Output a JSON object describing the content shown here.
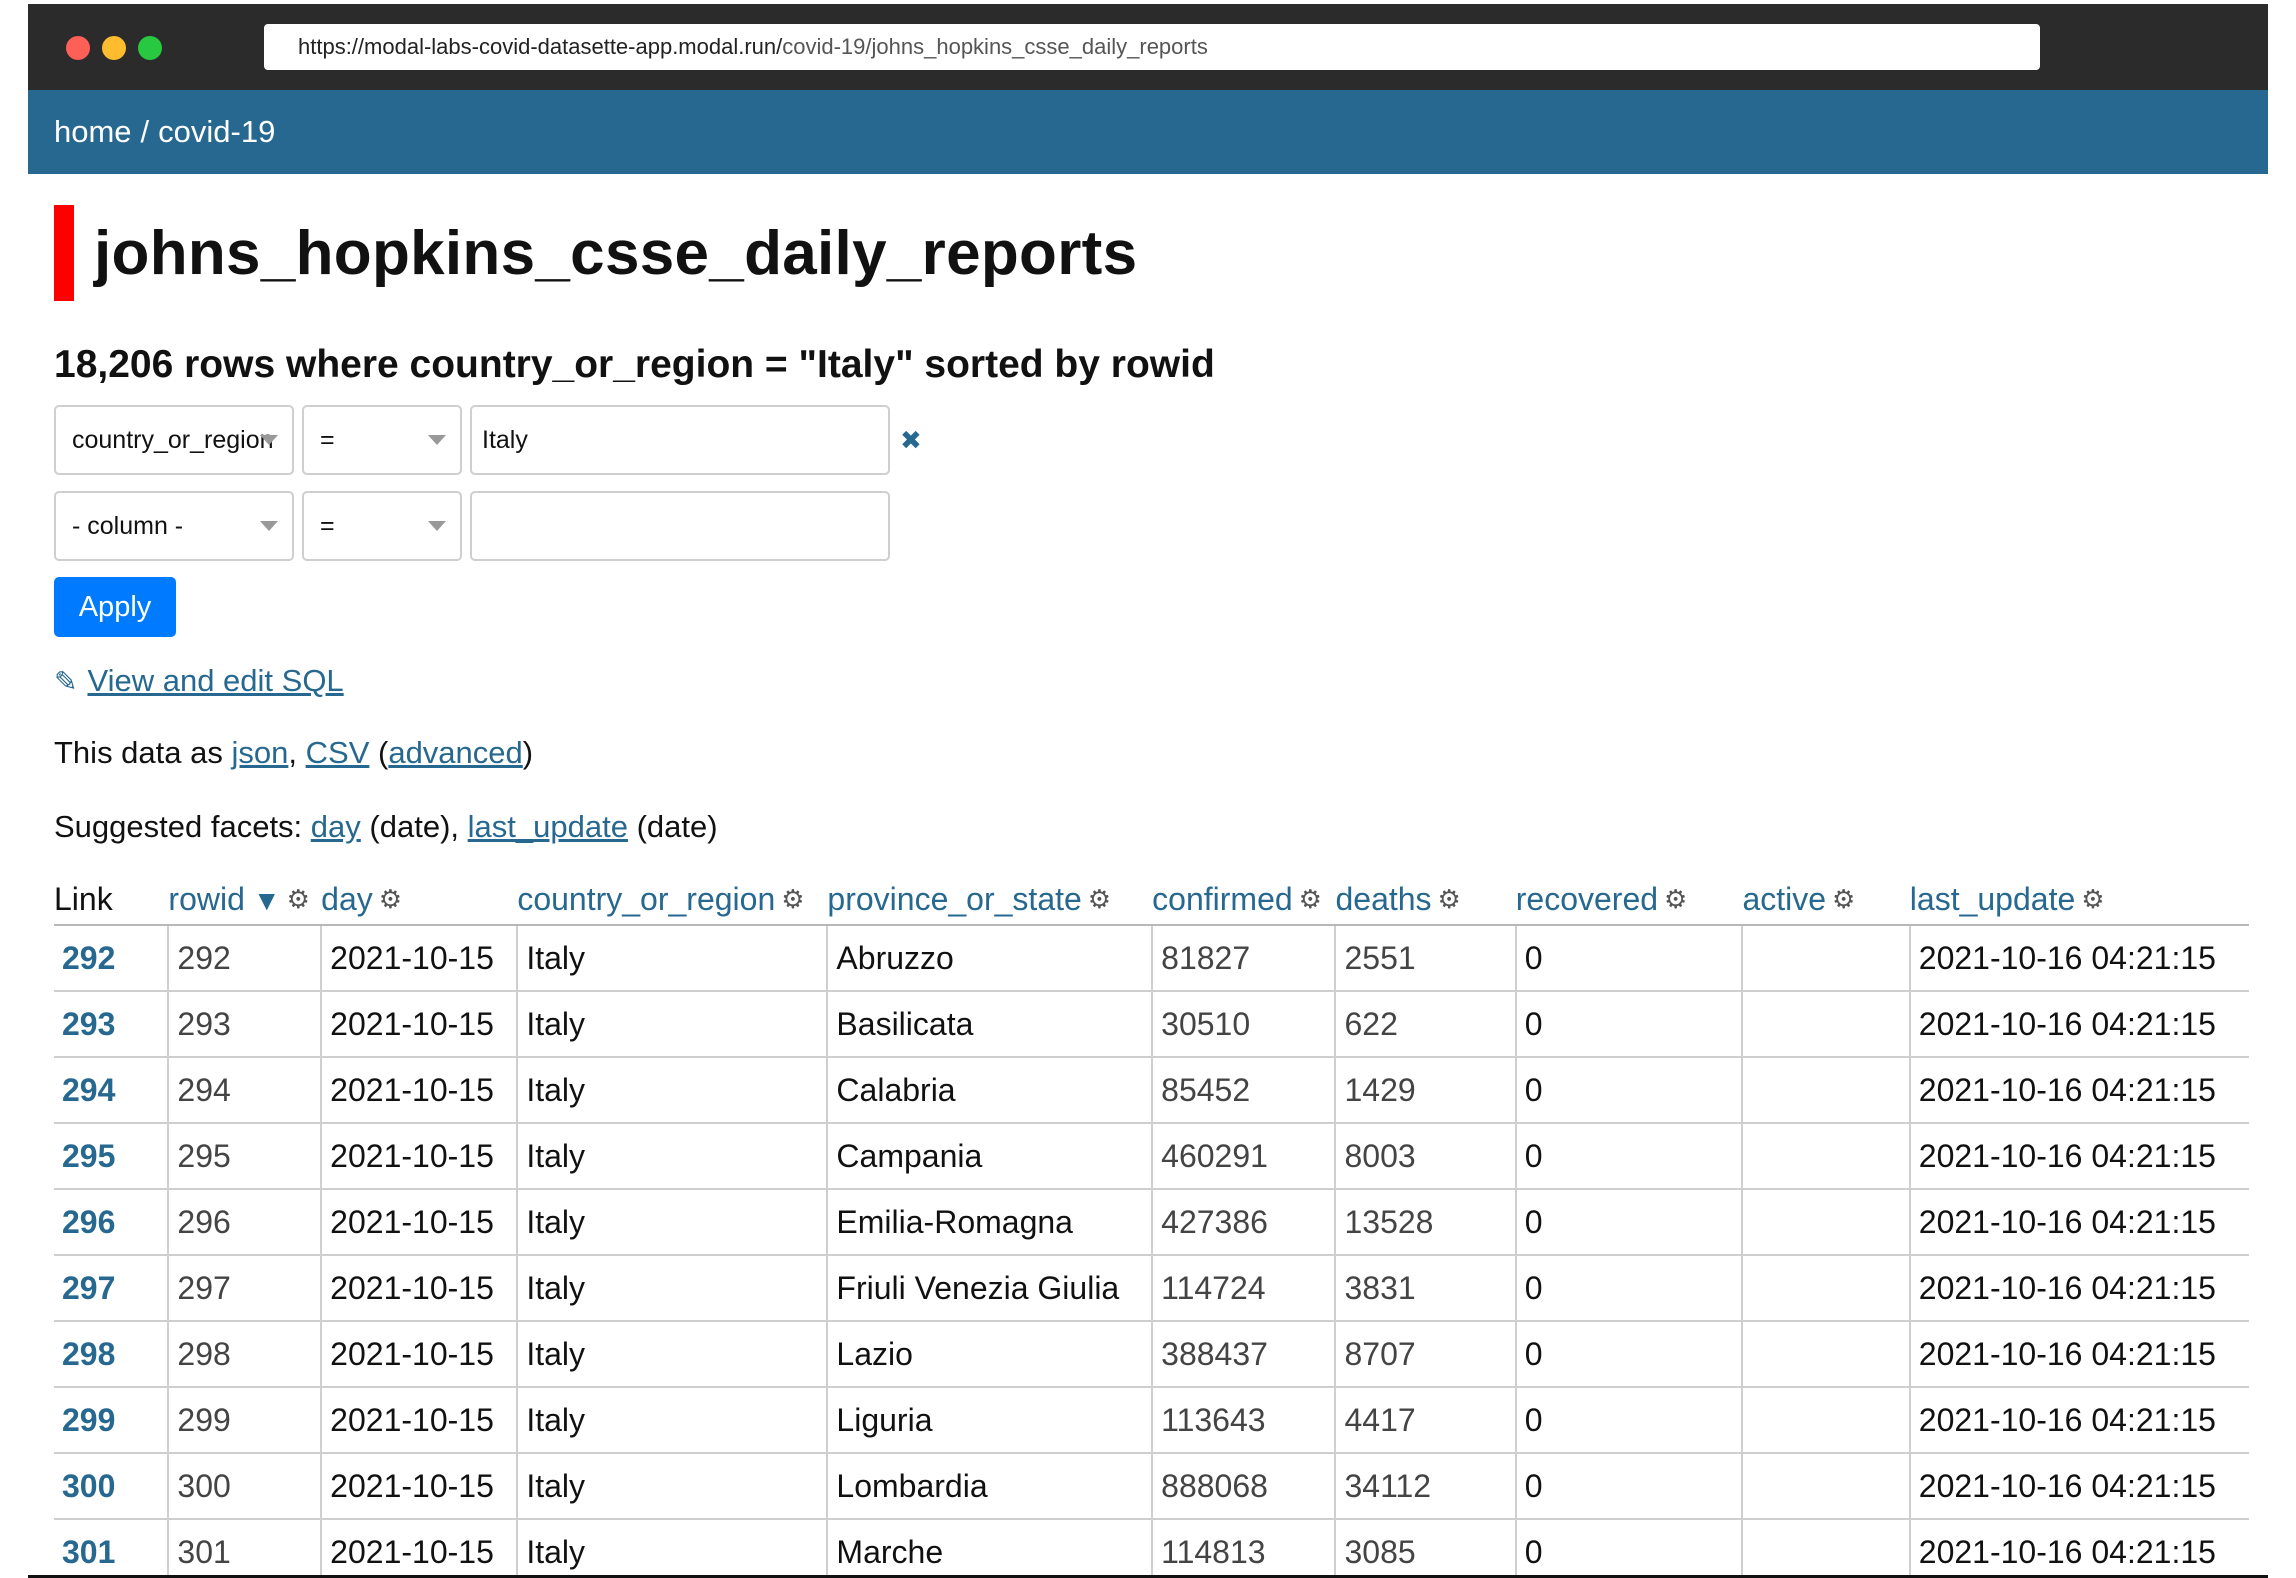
{
  "browser": {
    "url_host": "https://modal-labs-covid-datasette-app.modal.run/",
    "url_path": "covid-19/johns_hopkins_csse_daily_reports"
  },
  "breadcrumb": {
    "home": "home",
    "separator": "/",
    "database": "covid-19"
  },
  "page": {
    "title": "johns_hopkins_csse_daily_reports",
    "summary": "18,206 rows where country_or_region = \"Italy\" sorted by rowid"
  },
  "filters": {
    "row1": {
      "column": "country_or_region",
      "operator": "=",
      "value": "Italy",
      "remove_glyph": "✖"
    },
    "row2": {
      "column": "- column -",
      "operator": "=",
      "value": ""
    },
    "apply_label": "Apply"
  },
  "links": {
    "pencil_glyph": "✎",
    "sql_label": "View and edit SQL",
    "export_prefix": "This data as",
    "json": "json",
    "comma": ",",
    "csv": "CSV",
    "open_paren": "(",
    "advanced": "advanced",
    "close_paren": ")"
  },
  "facets": {
    "prefix": "Suggested facets:",
    "items": [
      {
        "name": "day",
        "kind": "(date)",
        "sep": ","
      },
      {
        "name": "last_update",
        "kind": "(date)",
        "sep": ""
      }
    ]
  },
  "table": {
    "sort_glyph": "▼",
    "gear_glyph": "⚙",
    "columns": [
      "Link",
      "rowid",
      "day",
      "country_or_region",
      "province_or_state",
      "confirmed",
      "deaths",
      "recovered",
      "active",
      "last_update"
    ],
    "rows": [
      [
        "292",
        "292",
        "2021-10-15",
        "Italy",
        "Abruzzo",
        "81827",
        "2551",
        "0",
        "",
        "2021-10-16 04:21:15"
      ],
      [
        "293",
        "293",
        "2021-10-15",
        "Italy",
        "Basilicata",
        "30510",
        "622",
        "0",
        "",
        "2021-10-16 04:21:15"
      ],
      [
        "294",
        "294",
        "2021-10-15",
        "Italy",
        "Calabria",
        "85452",
        "1429",
        "0",
        "",
        "2021-10-16 04:21:15"
      ],
      [
        "295",
        "295",
        "2021-10-15",
        "Italy",
        "Campania",
        "460291",
        "8003",
        "0",
        "",
        "2021-10-16 04:21:15"
      ],
      [
        "296",
        "296",
        "2021-10-15",
        "Italy",
        "Emilia-Romagna",
        "427386",
        "13528",
        "0",
        "",
        "2021-10-16 04:21:15"
      ],
      [
        "297",
        "297",
        "2021-10-15",
        "Italy",
        "Friuli Venezia Giulia",
        "114724",
        "3831",
        "0",
        "",
        "2021-10-16 04:21:15"
      ],
      [
        "298",
        "298",
        "2021-10-15",
        "Italy",
        "Lazio",
        "388437",
        "8707",
        "0",
        "",
        "2021-10-16 04:21:15"
      ],
      [
        "299",
        "299",
        "2021-10-15",
        "Italy",
        "Liguria",
        "113643",
        "4417",
        "0",
        "",
        "2021-10-16 04:21:15"
      ],
      [
        "300",
        "300",
        "2021-10-15",
        "Italy",
        "Lombardia",
        "888068",
        "34112",
        "0",
        "",
        "2021-10-16 04:21:15"
      ],
      [
        "301",
        "301",
        "2021-10-15",
        "Italy",
        "Marche",
        "114813",
        "3085",
        "0",
        "",
        "2021-10-16 04:21:15"
      ]
    ]
  }
}
